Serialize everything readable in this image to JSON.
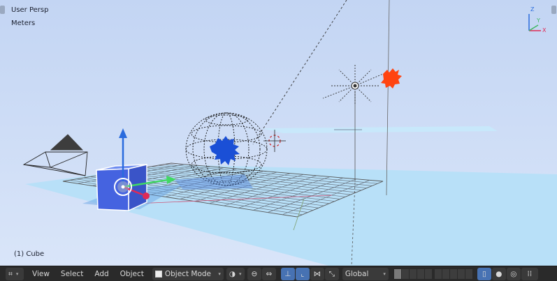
{
  "viewport": {
    "view_label": "User Persp",
    "units_label": "Meters",
    "object_info": "(1) Cube",
    "background_top": "#c3d5f3",
    "background_bottom": "#d9e5f9",
    "axes_gizmo": {
      "z": "Z",
      "x": "X",
      "y": "Y"
    }
  },
  "toolbar": {
    "editor_type_icon": "view3d-icon",
    "menus": [
      "View",
      "Select",
      "Add",
      "Object"
    ],
    "mode": "Object Mode",
    "orientation": "Global",
    "accent": "#4772b3"
  }
}
